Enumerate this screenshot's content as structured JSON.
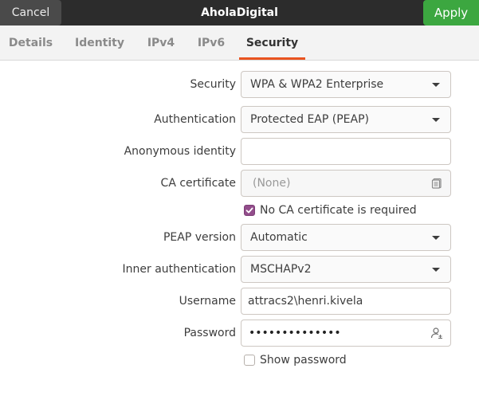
{
  "header": {
    "cancel_label": "Cancel",
    "title": "AholaDigital",
    "apply_label": "Apply"
  },
  "tabs": [
    {
      "label": "Details",
      "active": false
    },
    {
      "label": "Identity",
      "active": false
    },
    {
      "label": "IPv4",
      "active": false
    },
    {
      "label": "IPv6",
      "active": false
    },
    {
      "label": "Security",
      "active": true
    }
  ],
  "form": {
    "security": {
      "label": "Security",
      "value": "WPA & WPA2 Enterprise"
    },
    "authentication": {
      "label": "Authentication",
      "value": "Protected EAP (PEAP)"
    },
    "anonymous_identity": {
      "label": "Anonymous identity",
      "value": ""
    },
    "ca_certificate": {
      "label": "CA certificate",
      "value": "(None)"
    },
    "no_ca_required": {
      "label": "No CA certificate is required",
      "checked": true
    },
    "peap_version": {
      "label": "PEAP version",
      "value": "Automatic"
    },
    "inner_authentication": {
      "label": "Inner authentication",
      "value": "MSCHAPv2"
    },
    "username": {
      "label": "Username",
      "value": "attracs2\\henri.kivela"
    },
    "password": {
      "label": "Password",
      "value": "••••••••••••••"
    },
    "show_password": {
      "label": "Show password",
      "checked": false
    }
  },
  "colors": {
    "accent": "#e95420",
    "apply": "#3ca740",
    "checkbox": "#924d8b",
    "header": "#2c2c2c"
  },
  "icons": {
    "ca_certificate_button": "document-open-icon",
    "password_options": "user-lock-icon"
  }
}
